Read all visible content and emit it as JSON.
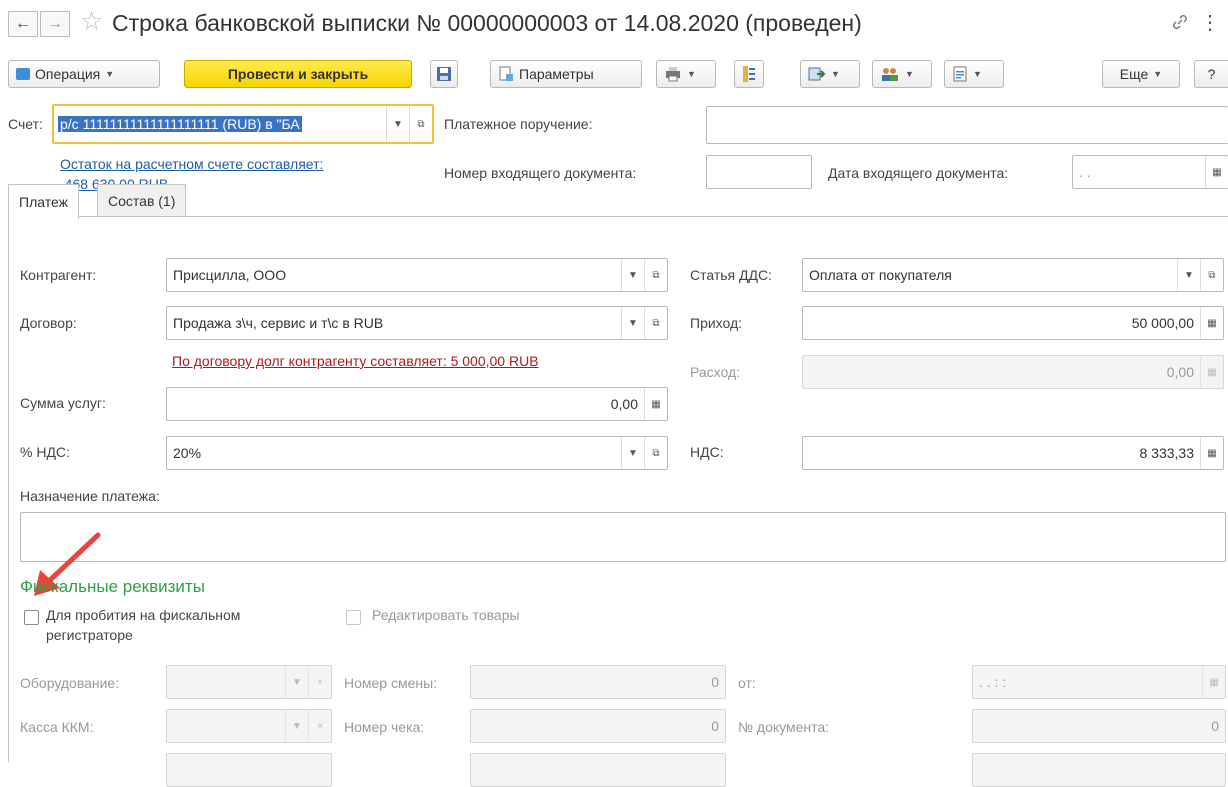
{
  "header": {
    "title": "Строка банковской выписки № 00000000003 от 14.08.2020 (проведен)",
    "back_icon": "←",
    "forward_icon": "→",
    "star_icon": "☆",
    "link_icon": "🔗",
    "more_icon": "⋮"
  },
  "toolbar": {
    "operation_label": "Операция",
    "post_close_label": "Провести и закрыть",
    "params_label": "Параметры",
    "more_label": "Еще",
    "help_label": "?"
  },
  "account": {
    "label": "Счет:",
    "value": "р/с 11111111111111111111 (RUB) в \"БА",
    "balance_line1": "Остаток на расчетном счете составляет:",
    "balance_line2": "-468 630,00 RUB"
  },
  "payment_order": {
    "label": "Платежное поручение:",
    "value": ""
  },
  "incoming": {
    "number_label": "Номер входящего документа:",
    "number_value": "",
    "date_label": "Дата входящего документа:",
    "date_value": ". ."
  },
  "tabs": [
    {
      "label": "Платеж",
      "active": true
    },
    {
      "label": "Состав (1)",
      "active": false
    }
  ],
  "payment": {
    "counterparty_label": "Контрагент:",
    "counterparty_value": "Присцилла, ООО",
    "contract_label": "Договор:",
    "contract_value": "Продажа з\\ч, сервис и т\\с в RUB",
    "debt_link": "По договору долг контрагенту составляет: 5 000,00 RUB",
    "services_label": "Сумма услуг:",
    "services_value": "0,00",
    "vat_rate_label": "% НДС:",
    "vat_rate_value": "20%",
    "dds_label": "Статья ДДС:",
    "dds_value": "Оплата от покупателя",
    "income_label": "Приход:",
    "income_value": "50 000,00",
    "expense_label": "Расход:",
    "expense_value": "0,00",
    "vat_label": "НДС:",
    "vat_value": "8 333,33",
    "purpose_label": "Назначение платежа:",
    "purpose_value": ""
  },
  "fiscal": {
    "heading": "Фискальные реквизиты",
    "print_fiscal_label_line1": "Для пробития на фискальном",
    "print_fiscal_label_line2": "регистраторе",
    "print_fiscal_checked": false,
    "edit_goods_label": "Редактировать товары",
    "edit_goods_checked": false,
    "equipment_label": "Оборудование:",
    "equipment_value": "",
    "shift_label": "Номер смены:",
    "shift_value": "0",
    "from_label": "от:",
    "from_value": ". . : :",
    "kkm_label": "Касса ККМ:",
    "kkm_value": "",
    "check_label": "Номер чека:",
    "check_value": "0",
    "doc_number_label": "№ документа:",
    "doc_number_value": "0"
  },
  "colors": {
    "accent_yellow": "#f6d400",
    "link_blue": "#1c5ca8",
    "debt_red": "#b0171f",
    "fiscal_green": "#2ea043",
    "arrow_red": "#e8453c"
  }
}
